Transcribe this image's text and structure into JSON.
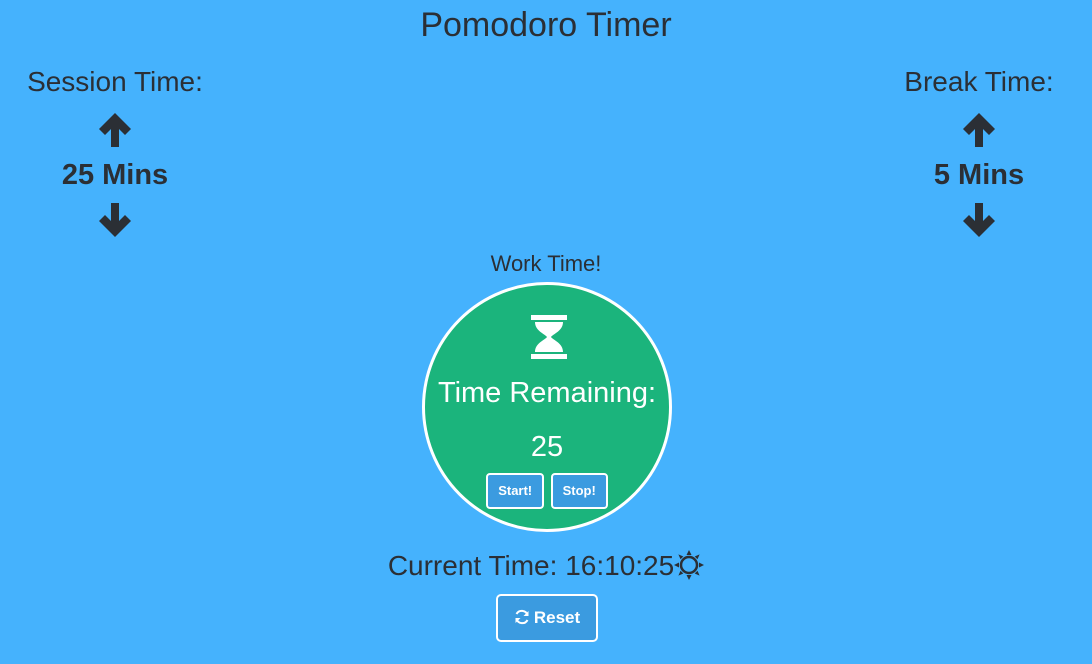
{
  "app": {
    "title": "Pomodoro Timer"
  },
  "session": {
    "label": "Session Time:",
    "value": "25 Mins"
  },
  "break": {
    "label": "Break Time:",
    "value": "5 Mins"
  },
  "timer": {
    "mode": "Work Time!",
    "remaining_label": "Time Remaining:",
    "remaining_value": "25",
    "start_label": "Start!",
    "stop_label": "Stop!"
  },
  "clock": {
    "text": "Current Time: 16:10:25"
  },
  "reset": {
    "label": "Reset"
  },
  "colors": {
    "background": "#45b2fd",
    "circle": "#1bb47c",
    "button": "#3b9be0",
    "text": "#2b2f35"
  },
  "icons": [
    "arrow-up-icon",
    "arrow-down-icon",
    "hourglass-icon",
    "sun-icon",
    "refresh-icon"
  ]
}
